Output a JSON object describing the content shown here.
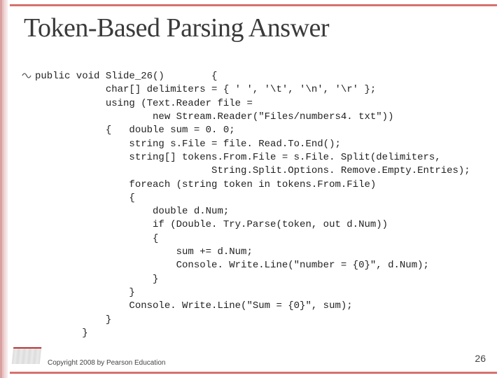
{
  "title": "Token-Based Parsing Answer",
  "bullet_glyph": "་་་",
  "bullet_style": "d",
  "code_lines": [
    "public void Slide_26()        {",
    "            char[] delimiters = { ' ', '\\t', '\\n', '\\r' };",
    "            using (Text.Reader file =",
    "                    new Stream.Reader(\"Files/numbers4. txt\"))",
    "            {   double sum = 0. 0;",
    "                string s.File = file. Read.To.End();",
    "                string[] tokens.From.File = s.File. Split(delimiters,",
    "                              String.Split.Options. Remove.Empty.Entries);",
    "                foreach (string token in tokens.From.File)",
    "                {",
    "                    double d.Num;",
    "                    if (Double. Try.Parse(token, out d.Num))",
    "                    {",
    "                        sum += d.Num;",
    "                        Console. Write.Line(\"number = {0}\", d.Num);",
    "                    }",
    "                }",
    "                Console. Write.Line(\"Sum = {0}\", sum);",
    "            }",
    "        }"
  ],
  "copyright": "Copyright 2008 by Pearson Education",
  "page_number": "26"
}
